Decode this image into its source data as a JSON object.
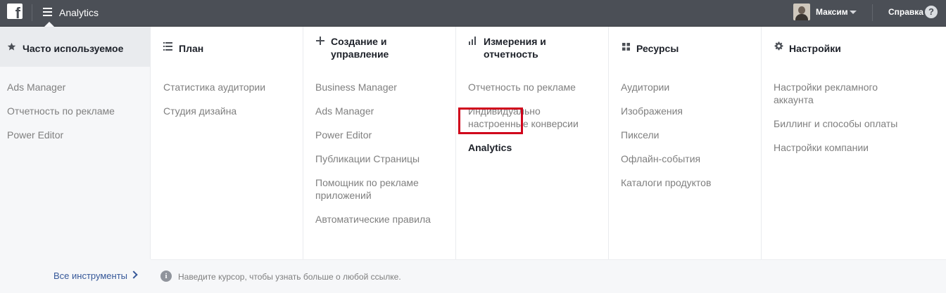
{
  "topbar": {
    "logo": "f",
    "app_title": "Analytics",
    "user_name": "Максим",
    "help_label": "Справка",
    "help_icon": "?"
  },
  "columns": [
    {
      "title": "Часто используемое",
      "icon": "star-icon",
      "items": [
        "Ads Manager",
        "Отчетность по рекламе",
        "Power Editor"
      ]
    },
    {
      "title": "План",
      "icon": "list-icon",
      "items": [
        "Статистика аудитории",
        "Студия дизайна"
      ]
    },
    {
      "title": "Создание и управление",
      "icon": "plus-icon",
      "items": [
        "Business Manager",
        "Ads Manager",
        "Power Editor",
        "Публикации Страницы",
        "Помощник по рекламе приложений",
        "Автоматические правила"
      ]
    },
    {
      "title": "Измерения и отчетность",
      "icon": "bar-chart-icon",
      "items": [
        "Отчетность по рекламе",
        "Индивидуально настроенные конверсии",
        "Analytics"
      ],
      "highlighted_item": "Analytics"
    },
    {
      "title": "Ресурсы",
      "icon": "grid-icon",
      "items": [
        "Аудитории",
        "Изображения",
        "Пиксели",
        "Офлайн-события",
        "Каталоги продуктов"
      ]
    },
    {
      "title": "Настройки",
      "icon": "gear-icon",
      "items": [
        "Настройки рекламного аккаунта",
        "Биллинг и способы оплаты",
        "Настройки компании"
      ]
    }
  ],
  "footer": {
    "all_tools": "Все инструменты",
    "info_icon": "i",
    "hint": "Наведите курсор, чтобы узнать больше о любой ссылке."
  },
  "colors": {
    "topbar": "#4b4f56",
    "highlight_border": "#d0021b",
    "link": "#365899",
    "item_text": "#7f7f7f",
    "sidebar_bg": "#f6f7f9"
  }
}
